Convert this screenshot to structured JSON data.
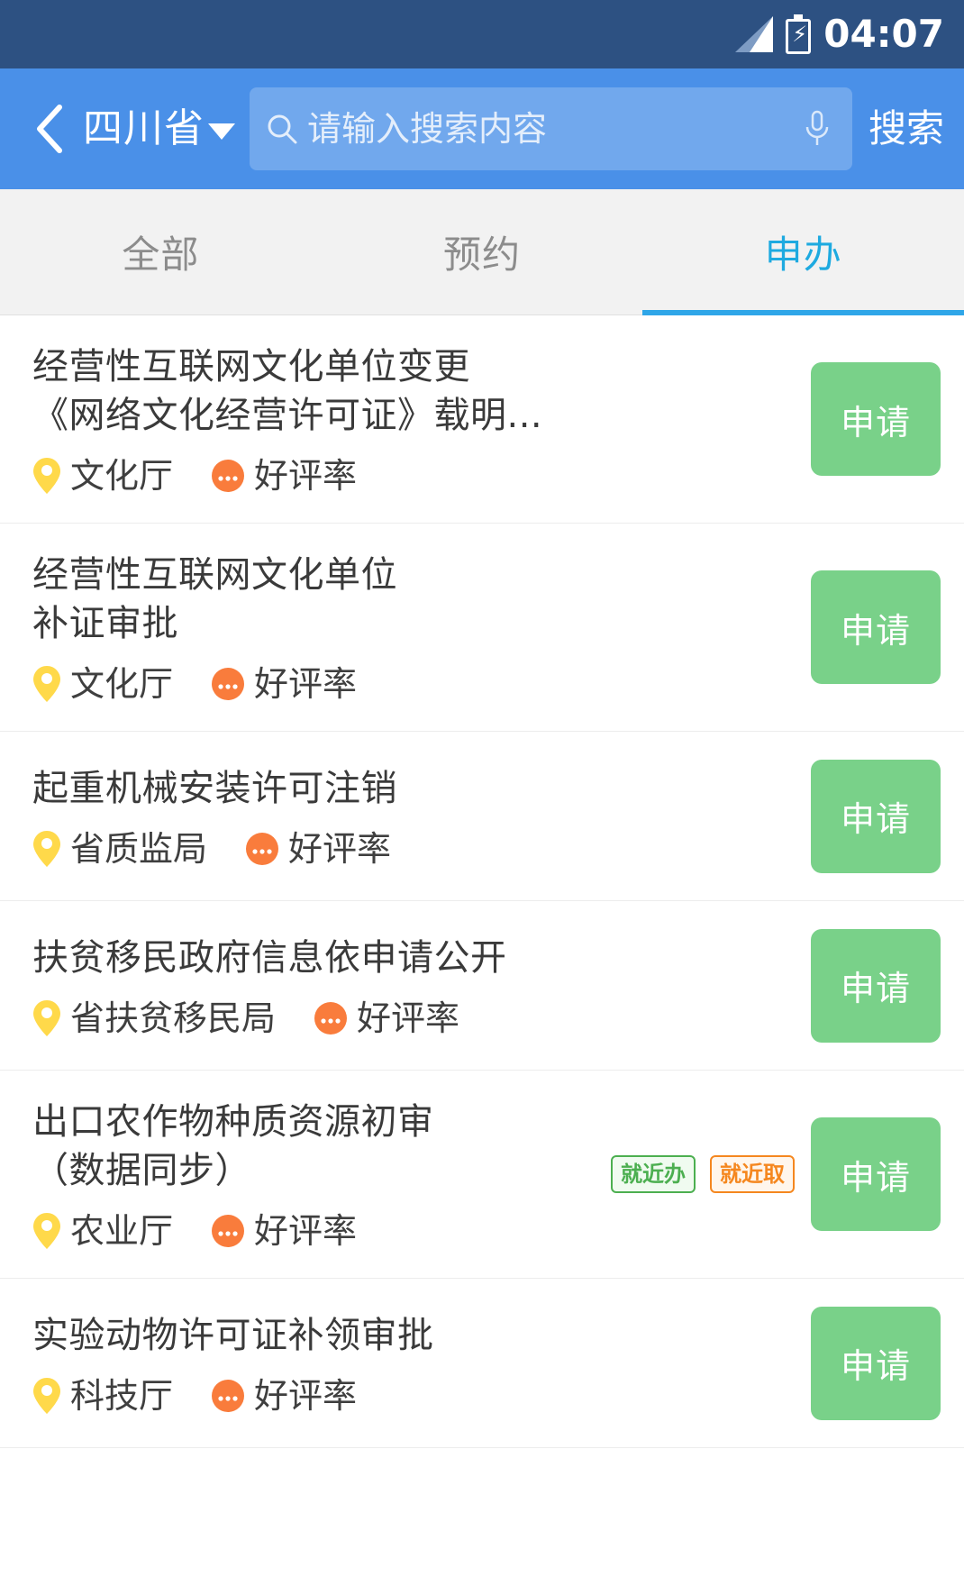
{
  "status_bar": {
    "time": "04:07",
    "signal_icon": "signal-bars-icon",
    "battery_icon": "battery-charging-icon"
  },
  "app_bar": {
    "back_icon": "back-chevron-icon",
    "region": "四川省",
    "region_caret_icon": "caret-down-icon",
    "search": {
      "icon": "search-icon",
      "value": "",
      "placeholder": "请输入搜索内容",
      "mic_icon": "microphone-icon"
    },
    "search_action_label": "搜索",
    "accent_color": "#4a90e8"
  },
  "tabs": {
    "items": [
      {
        "label": "全部",
        "active": false
      },
      {
        "label": "预约",
        "active": false
      },
      {
        "label": "申办",
        "active": true
      }
    ],
    "active_color": "#1eaae0",
    "inactive_color": "#8c8c8c",
    "indicator_color": "#2fa6e8"
  },
  "icons": {
    "location": "location-pin-icon",
    "rating": "rating-dots-icon"
  },
  "apply_button_label": "申请",
  "apply_button_color": "#79d189",
  "list": [
    {
      "title": "经营性互联网文化单位变更\n《网络文化经营许可证》载明...",
      "agency": "文化厅",
      "rating_label": "好评率",
      "badges": []
    },
    {
      "title": "经营性互联网文化单位\n补证审批",
      "agency": "文化厅",
      "rating_label": "好评率",
      "badges": []
    },
    {
      "title": "起重机械安装许可注销",
      "agency": "省质监局",
      "rating_label": "好评率",
      "badges": []
    },
    {
      "title": "扶贫移民政府信息依申请公开",
      "agency": "省扶贫移民局",
      "rating_label": "好评率",
      "badges": []
    },
    {
      "title": "出口农作物种质资源初审\n（数据同步）",
      "agency": "农业厅",
      "rating_label": "好评率",
      "badges": [
        {
          "label": "就近办",
          "style": "green"
        },
        {
          "label": "就近取",
          "style": "orange"
        }
      ]
    },
    {
      "title": "实验动物许可证补领审批",
      "agency": "科技厅",
      "rating_label": "好评率",
      "badges": []
    }
  ]
}
